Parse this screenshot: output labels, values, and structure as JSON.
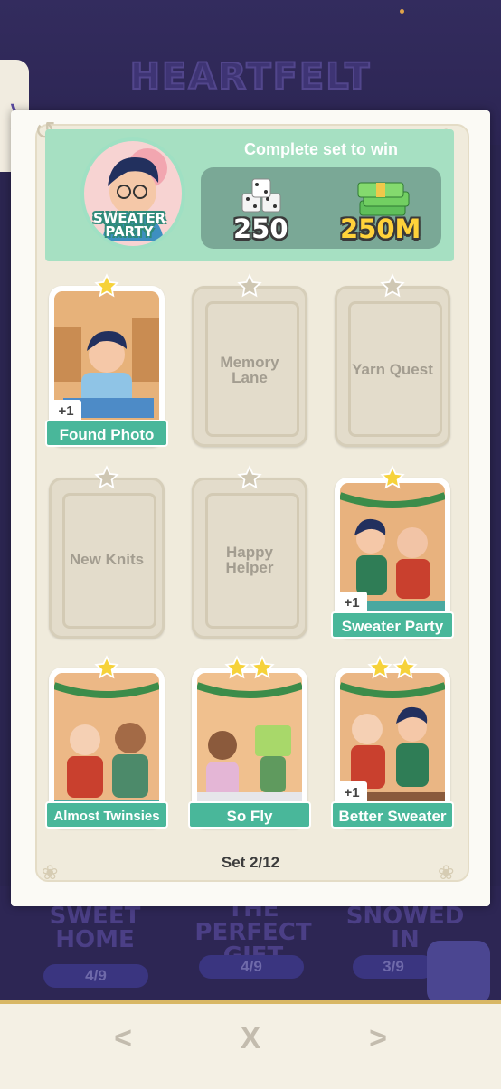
{
  "background": {
    "album_title": "HEARTFELT",
    "side_tab_icon": "chevron-right-icon",
    "other_sets": [
      {
        "name_lines": [
          "SWEET",
          "HOME"
        ],
        "progress": "4/9"
      },
      {
        "name_lines": [
          "THE PERFECT",
          "GIFT"
        ],
        "progress": "4/9"
      },
      {
        "name_lines": [
          "SNOWED IN"
        ],
        "progress": "3/9"
      }
    ]
  },
  "set_card": {
    "set_name_lines": [
      "SWEATER",
      "PARTY"
    ],
    "reward_caption": "Complete set to win",
    "rewards": [
      {
        "icon": "dice-icon",
        "value": "250"
      },
      {
        "icon": "cash-stack-icon",
        "value": "250M"
      }
    ],
    "progress_text": "Set 2/12"
  },
  "stickers": [
    {
      "name": "Found Photo",
      "stars": 1,
      "collected": true,
      "extra": "+1"
    },
    {
      "name_lines": [
        "Memory",
        "Lane"
      ],
      "stars": 1,
      "collected": false
    },
    {
      "name_lines": [
        "Yarn Quest"
      ],
      "stars": 1,
      "collected": false
    },
    {
      "name_lines": [
        "New Knits"
      ],
      "stars": 1,
      "collected": false
    },
    {
      "name_lines": [
        "Happy",
        "Helper"
      ],
      "stars": 1,
      "collected": false
    },
    {
      "name": "Sweater Party",
      "stars": 1,
      "collected": true,
      "extra": "+1"
    },
    {
      "name": "Almost Twinsies",
      "stars": 1,
      "collected": true
    },
    {
      "name": "So Fly",
      "stars": 2,
      "collected": true
    },
    {
      "name": "Better Sweater",
      "stars": 2,
      "collected": true,
      "extra": "+1"
    }
  ],
  "navigation": {
    "prev_label": "<",
    "close_label": "X",
    "next_label": ">"
  },
  "colors": {
    "banner_green": "#a6e0c2",
    "label_green": "#49b79a",
    "star_gold": "#f6d23a",
    "star_gray": "#cfc7b3"
  }
}
